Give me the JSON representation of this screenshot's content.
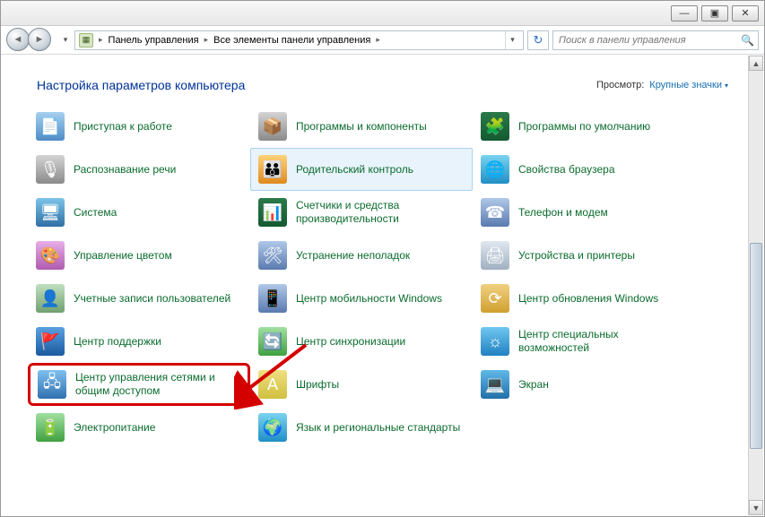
{
  "titlebar": {
    "minimize": "—",
    "maximize": "▣",
    "close": "✕"
  },
  "nav": {
    "back_glyph": "◄",
    "fwd_glyph": "►",
    "dd_glyph": "▾"
  },
  "breadcrumb": {
    "seg1": "Панель управления",
    "seg2": "Все элементы панели управления",
    "sep": "▸"
  },
  "refresh_glyph": "↻",
  "search": {
    "placeholder": "Поиск в панели управления",
    "icon": "🔍"
  },
  "heading": "Настройка параметров компьютера",
  "view": {
    "label": "Просмотр:",
    "value": "Крупные значки",
    "tri": "▾"
  },
  "items": [
    {
      "label": "Приступая к работе",
      "icon": "📄"
    },
    {
      "label": "Программы и компоненты",
      "icon": "📦"
    },
    {
      "label": "Программы по умолчанию",
      "icon": "🧩"
    },
    {
      "label": "Распознавание речи",
      "icon": "🎙"
    },
    {
      "label": "Родительский контроль",
      "icon": "👪"
    },
    {
      "label": "Свойства браузера",
      "icon": "🌐"
    },
    {
      "label": "Система",
      "icon": "🖥"
    },
    {
      "label": "Счетчики и средства производительности",
      "icon": "📊"
    },
    {
      "label": "Телефон и модем",
      "icon": "☎"
    },
    {
      "label": "Управление цветом",
      "icon": "🎨"
    },
    {
      "label": "Устранение неполадок",
      "icon": "🛠"
    },
    {
      "label": "Устройства и принтеры",
      "icon": "🖨"
    },
    {
      "label": "Учетные записи пользователей",
      "icon": "👤"
    },
    {
      "label": "Центр мобильности Windows",
      "icon": "📱"
    },
    {
      "label": "Центр обновления Windows",
      "icon": "⟳"
    },
    {
      "label": "Центр поддержки",
      "icon": "🚩"
    },
    {
      "label": "Центр синхронизации",
      "icon": "🔄"
    },
    {
      "label": "Центр специальных возможностей",
      "icon": "☼"
    },
    {
      "label": "Центр управления сетями и общим доступом",
      "icon": "🖧"
    },
    {
      "label": "Шрифты",
      "icon": "A"
    },
    {
      "label": "Экран",
      "icon": "💻"
    },
    {
      "label": "Электропитание",
      "icon": "🔋"
    },
    {
      "label": "Язык и региональные стандарты",
      "icon": "🌍"
    }
  ]
}
